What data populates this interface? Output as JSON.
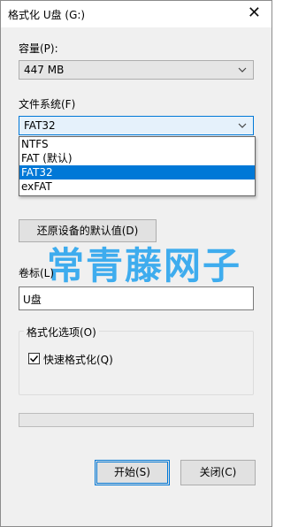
{
  "window": {
    "title": "格式化 U盘 (G:)",
    "close_glyph": "✕"
  },
  "capacity": {
    "label": "容量(P):",
    "value": "447 MB"
  },
  "filesystem": {
    "label": "文件系统(F)",
    "value": "FAT32",
    "options": [
      {
        "label": "NTFS",
        "selected": false
      },
      {
        "label": "FAT (默认)",
        "selected": false
      },
      {
        "label": "FAT32",
        "selected": true
      },
      {
        "label": "exFAT",
        "selected": false
      }
    ]
  },
  "restore_button": {
    "label": "还原设备的默认值(D)"
  },
  "volume": {
    "label": "卷标(L)",
    "value": "U盘"
  },
  "format_options": {
    "legend": "格式化选项(O)",
    "quick_format": {
      "label": "快速格式化(Q)",
      "checked": true
    }
  },
  "progress": {
    "value": 0
  },
  "buttons": {
    "start": "开始(S)",
    "close": "关闭(C)"
  },
  "watermark": {
    "text": "常青藤网子"
  },
  "colors": {
    "accent": "#0078d7",
    "watermark": "#2fa7ee",
    "progress": "#06b025"
  },
  "icons": {
    "dropdown": "chevron-down-icon",
    "check": "checkmark-icon"
  }
}
